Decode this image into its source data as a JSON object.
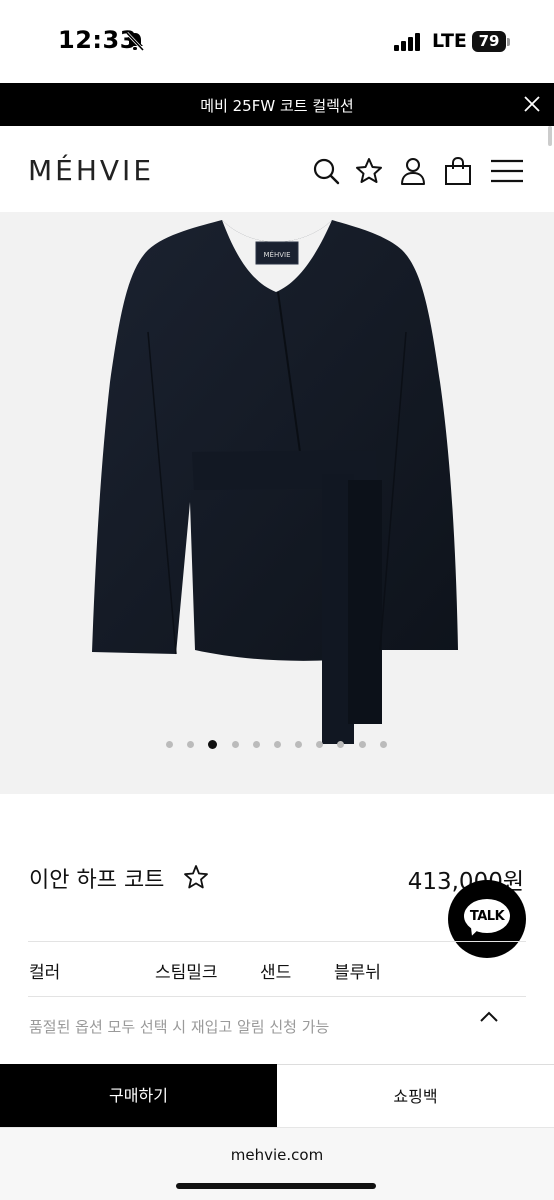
{
  "status_bar": {
    "time": "12:33",
    "network": "LTE",
    "battery": "79"
  },
  "promo_banner": {
    "text": "메비 25FW 코트 컬렉션"
  },
  "header": {
    "brand": "MÉHVIE",
    "icons": [
      "search-icon",
      "star-icon",
      "user-icon",
      "shopping-bag-icon",
      "menu-icon"
    ]
  },
  "product_image": {
    "label_text": "MÉHVIE",
    "slide_count": 11,
    "active_slide": 3,
    "jacket_color": "#141a24"
  },
  "product": {
    "name": "이안 하프 코트",
    "price": "413,000원"
  },
  "chat": {
    "label": "TALK"
  },
  "color_option": {
    "label": "컬러",
    "options": [
      "스팀밀크",
      "샌드",
      "블루뉘"
    ]
  },
  "notice": {
    "text": "품절된 옵션 모두 선택 시 재입고 알림 신청 가능"
  },
  "actions": {
    "buy_label": "구매하기",
    "bag_label": "쇼핑백"
  },
  "browser": {
    "url": "mehvie.com"
  },
  "colors": {
    "banner_bg": "#000000",
    "buy_bg": "#000000",
    "image_bg": "#f2f2f2"
  }
}
